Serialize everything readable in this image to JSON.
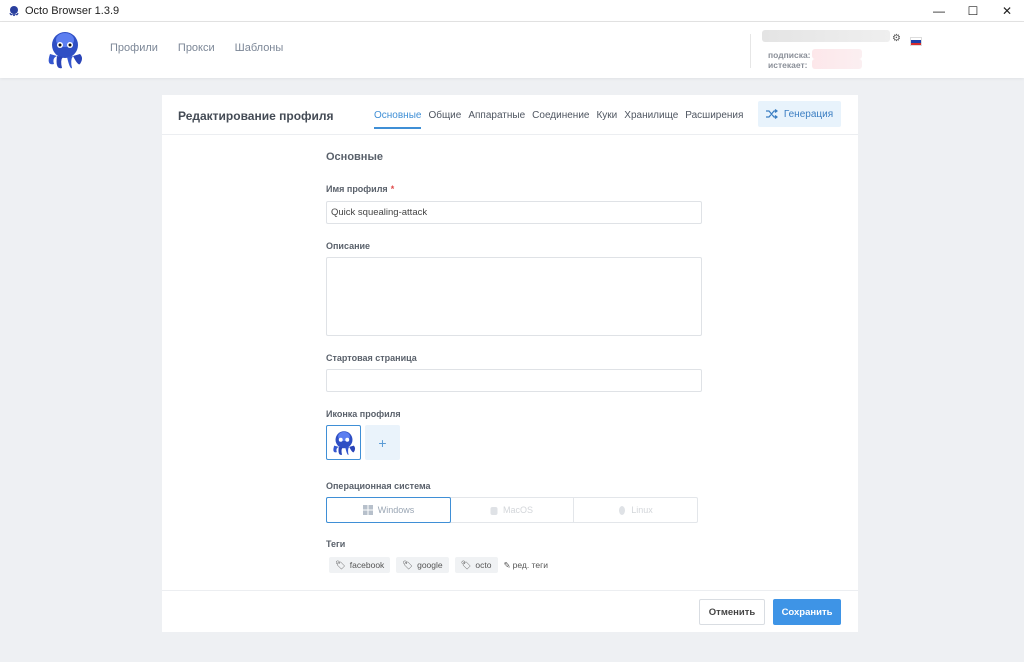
{
  "window": {
    "title": "Octo Browser 1.3.9",
    "minimize": "—",
    "maximize": "☐",
    "close": "✕"
  },
  "header": {
    "nav": [
      "Профили",
      "Прокси",
      "Шаблоны"
    ],
    "subscription_label": "подписка:",
    "expires_label": "истекает:"
  },
  "editor": {
    "title": "Редактирование профиля",
    "tabs": [
      "Основные",
      "Общие",
      "Аппаратные",
      "Соединение",
      "Куки",
      "Хранилище",
      "Расширения"
    ],
    "active_tab": 0,
    "generate_label": "Генерация"
  },
  "form": {
    "section_title": "Основные",
    "name_label": "Имя профиля",
    "required_mark": "*",
    "name_value": "Quick squealing-attack",
    "description_label": "Описание",
    "description_value": "",
    "start_page_label": "Стартовая страница",
    "start_page_value": "",
    "icon_label": "Иконка профиля",
    "add_icon": "+",
    "os_label": "Операционная система",
    "os_options": [
      "Windows",
      "MacOS",
      "Linux"
    ],
    "os_selected": "Windows",
    "tags_label": "Теги",
    "tags": [
      "facebook",
      "google",
      "octo"
    ],
    "edit_tags_label": "ред. теги"
  },
  "footer": {
    "cancel_label": "Отменить",
    "save_label": "Сохранить"
  },
  "colors": {
    "accent": "#3f8fd6",
    "save_button": "#3e94e6",
    "required": "#e04b4b",
    "page_bg": "#eef0f3"
  }
}
